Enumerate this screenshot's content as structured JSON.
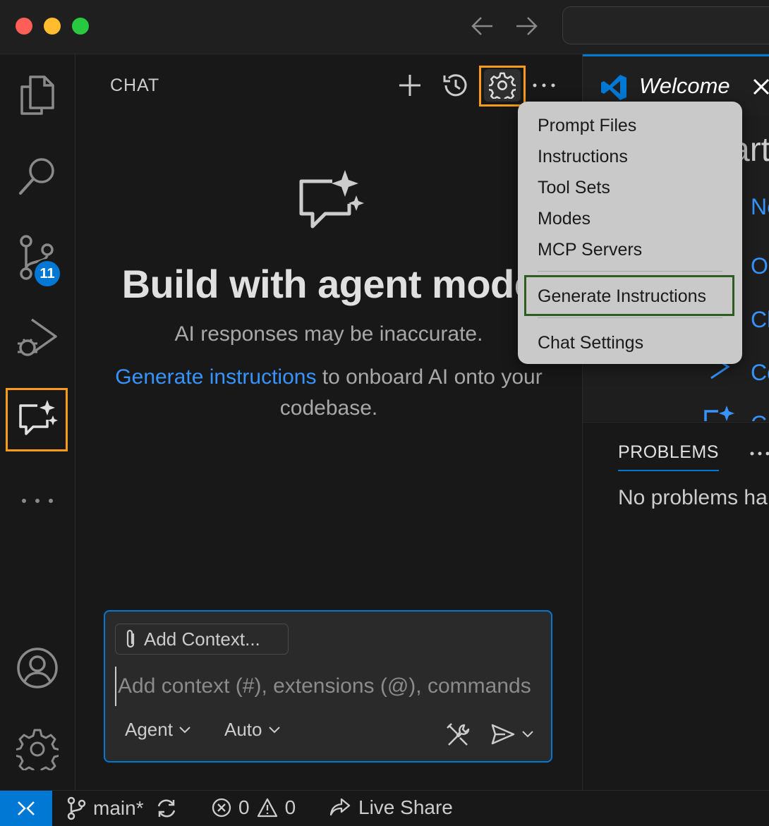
{
  "chat": {
    "title": "CHAT",
    "hero_title": "Build with agent mode",
    "hero_subtitle": "AI responses may be inaccurate.",
    "hero_link": "Generate instructions",
    "hero_line_rest": " to onboard AI onto your codebase.",
    "add_context_label": "Add Context...",
    "input_placeholder": "Add context (#), extensions (@), commands",
    "mode_picker": "Agent",
    "model_picker": "Auto"
  },
  "activity_bar": {
    "source_control_badge": "11"
  },
  "menu": {
    "items": [
      "Prompt Files",
      "Instructions",
      "Tool Sets",
      "Modes",
      "MCP Servers"
    ],
    "generate_instructions": "Generate Instructions",
    "chat_settings": "Chat Settings"
  },
  "editor": {
    "tab_label": "Welcome",
    "partial_heading": "art",
    "partial_links": [
      "Ne",
      "Op",
      "Cl",
      "Co",
      "C"
    ]
  },
  "panel": {
    "problems_tab": "PROBLEMS",
    "no_problems": "No problems ha"
  },
  "statusbar": {
    "branch": "main*",
    "errors": "0",
    "warnings": "0",
    "live_share": "Live Share"
  },
  "colors": {
    "accent": "#0078d4",
    "highlight_orange": "#f59d1b",
    "highlight_green": "#2e5c22",
    "link": "#3794ff"
  }
}
